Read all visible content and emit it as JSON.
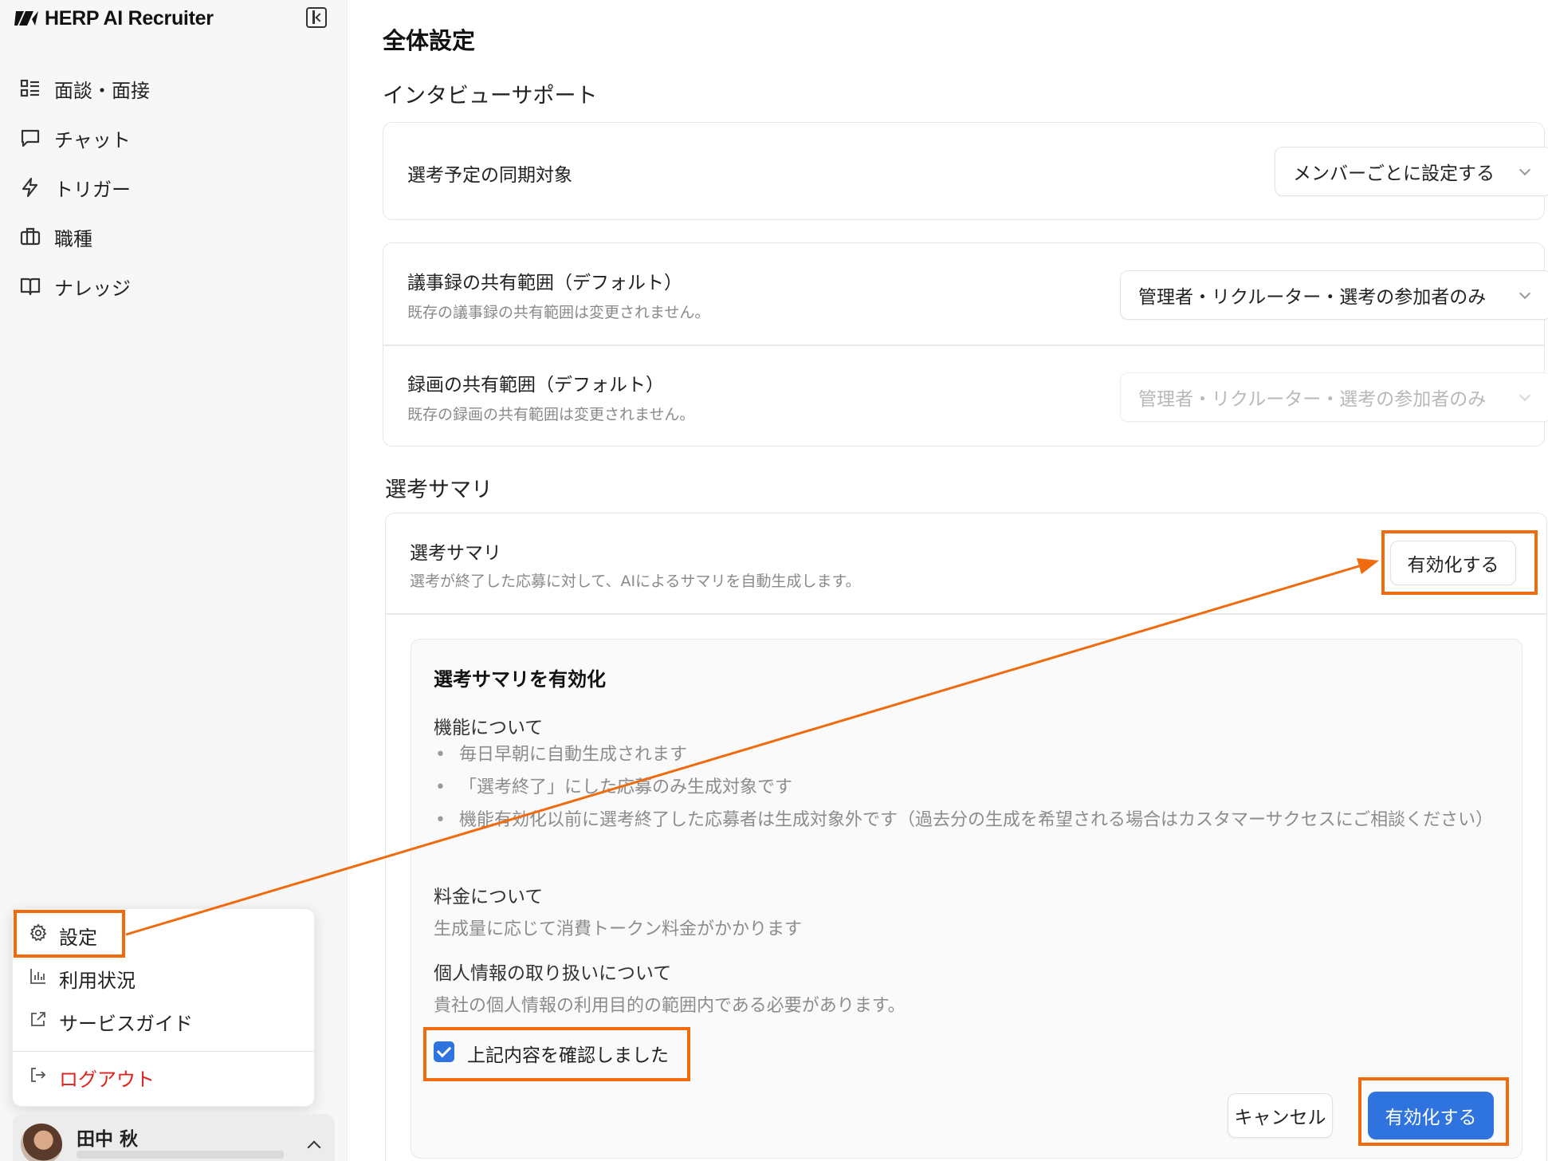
{
  "app": {
    "name": "HERP AI Recruiter"
  },
  "sidebar": {
    "items": [
      {
        "label": "面談・面接",
        "icon": "grid-list-icon"
      },
      {
        "label": "チャット",
        "icon": "chat-icon"
      },
      {
        "label": "トリガー",
        "icon": "lightning-icon"
      },
      {
        "label": "職種",
        "icon": "briefcase-icon"
      },
      {
        "label": "ナレッジ",
        "icon": "book-icon"
      }
    ],
    "menu": {
      "settings": "設定",
      "usage": "利用状況",
      "guide": "サービスガイド",
      "logout": "ログアウト"
    },
    "user": {
      "name": "田中 秋"
    }
  },
  "main": {
    "page_title": "全体設定",
    "interview_support": {
      "title": "インタビューサポート",
      "sync_target": {
        "label": "選考予定の同期対象",
        "value": "メンバーごとに設定する"
      },
      "minutes_scope": {
        "label": "議事録の共有範囲（デフォルト）",
        "sub": "既存の議事録の共有範囲は変更されません。",
        "value": "管理者・リクルーター・選考の参加者のみ"
      },
      "recording_scope": {
        "label": "録画の共有範囲（デフォルト）",
        "sub": "既存の録画の共有範囲は変更されません。",
        "value": "管理者・リクルーター・選考の参加者のみ"
      }
    },
    "selection_summary": {
      "title": "選考サマリ",
      "row_label": "選考サマリ",
      "row_sub": "選考が終了した応募に対して、AIによるサマリを自動生成します。",
      "enable_button": "有効化する",
      "panel": {
        "title": "選考サマリを有効化",
        "feature_heading": "機能について",
        "feature_items": [
          "毎日早朝に自動生成されます",
          "「選考終了」にした応募のみ生成対象です",
          "機能有効化以前に選考終了した応募者は生成対象外です（過去分の生成を希望される場合はカスタマーサクセスにご相談ください）"
        ],
        "pricing_heading": "料金について",
        "pricing_text": "生成量に応じて消費トークン料金がかかります",
        "privacy_heading": "個人情報の取り扱いについて",
        "privacy_text": "貴社の個人情報の利用目的の範囲内である必要があります。",
        "confirm_label": "上記内容を確認しました",
        "confirm_checked": true,
        "cancel_button": "キャンセル",
        "submit_button": "有効化する"
      }
    }
  },
  "colors": {
    "accent": "#2f73df",
    "annotation": "#f06a0e",
    "logout": "#e0211c"
  }
}
